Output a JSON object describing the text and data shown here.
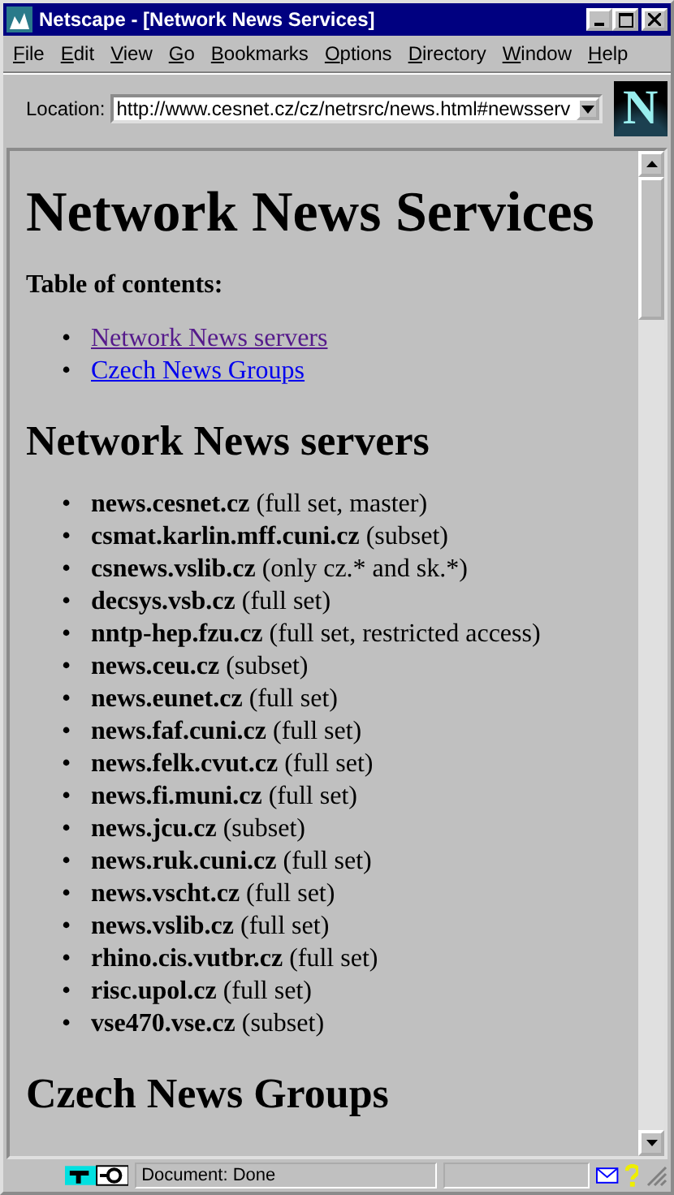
{
  "window": {
    "title": "Netscape - [Network News Services]"
  },
  "menu": [
    "File",
    "Edit",
    "View",
    "Go",
    "Bookmarks",
    "Options",
    "Directory",
    "Window",
    "Help"
  ],
  "location": {
    "label": "Location:",
    "value": "http://www.cesnet.cz/cz/netrsrc/news.html#newsserv"
  },
  "logo": "N",
  "page": {
    "bullet": "•",
    "title": "Network News Services",
    "toc_heading": "Table of contents:",
    "toc": [
      {
        "label": "Network News servers",
        "visited": true
      },
      {
        "label": "Czech News Groups",
        "visited": false
      }
    ],
    "servers_heading": "Network News servers",
    "servers": [
      {
        "host": "news.cesnet.cz",
        "note": "(full set, master)"
      },
      {
        "host": "csmat.karlin.mff.cuni.cz",
        "note": "(subset)"
      },
      {
        "host": "csnews.vslib.cz",
        "note": "(only cz.* and sk.*)"
      },
      {
        "host": "decsys.vsb.cz",
        "note": "(full set)"
      },
      {
        "host": "nntp-hep.fzu.cz",
        "note": "(full set, restricted access)"
      },
      {
        "host": "news.ceu.cz",
        "note": "(subset)"
      },
      {
        "host": "news.eunet.cz",
        "note": "(full set)"
      },
      {
        "host": "news.faf.cuni.cz",
        "note": "(full set)"
      },
      {
        "host": "news.felk.cvut.cz",
        "note": "(full set)"
      },
      {
        "host": "news.fi.muni.cz",
        "note": "(full set)"
      },
      {
        "host": "news.jcu.cz",
        "note": "(subset)"
      },
      {
        "host": "news.ruk.cuni.cz",
        "note": "(full set)"
      },
      {
        "host": "news.vscht.cz",
        "note": "(full set)"
      },
      {
        "host": "news.vslib.cz",
        "note": "(full set)"
      },
      {
        "host": "rhino.cis.vutbr.cz",
        "note": "(full set)"
      },
      {
        "host": "risc.upol.cz",
        "note": "(full set)"
      },
      {
        "host": "vse470.vse.cz",
        "note": "(subset)"
      }
    ],
    "groups_heading": "Czech News Groups"
  },
  "status_bar": {
    "text": "Document: Done"
  }
}
